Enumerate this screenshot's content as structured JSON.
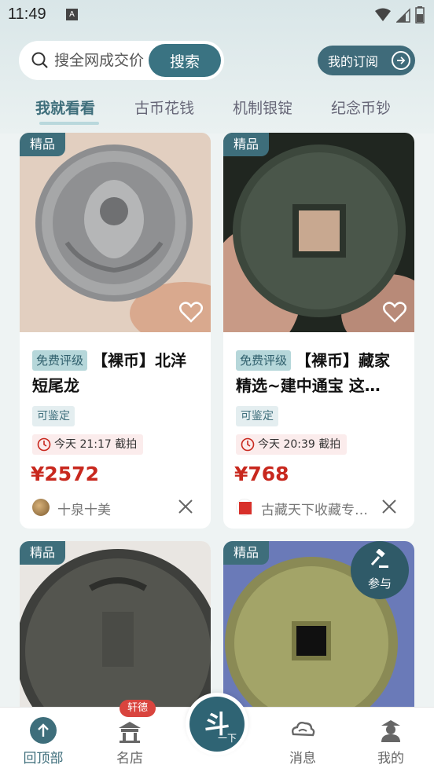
{
  "status_bar": {
    "time": "11:49",
    "notif_glyph": "A"
  },
  "search": {
    "placeholder": "搜全网成交价",
    "button_label": "搜索"
  },
  "subscribe": {
    "label": "我的订阅",
    "icon": "arrow-right-circle-icon"
  },
  "tabs": [
    {
      "label": "我就看看",
      "active": true
    },
    {
      "label": "古币花钱",
      "active": false
    },
    {
      "label": "机制银锭",
      "active": false
    },
    {
      "label": "纪念币钞",
      "active": false
    }
  ],
  "cards": [
    {
      "badge": "精品",
      "free_badge": "免费评级",
      "title": "【裸币】北洋短尾龙",
      "identify": "可鉴定",
      "time": "今天 21:17 截拍",
      "price": "¥2572",
      "seller": "十泉十美"
    },
    {
      "badge": "精品",
      "free_badge": "免费评级",
      "title": "【裸币】藏家精选~建中通宝 这…",
      "identify": "可鉴定",
      "time": "今天 20:39 截拍",
      "price": "¥768",
      "seller": "古藏天下收藏专…"
    },
    {
      "badge": "精品"
    },
    {
      "badge": "精品"
    }
  ],
  "participate": {
    "label": "参与"
  },
  "bottom_nav": {
    "items": [
      {
        "label": "回顶部",
        "icon": "arrow-up-icon",
        "active": true
      },
      {
        "label": "名店",
        "icon": "shop-icon",
        "badge": "轩德"
      },
      {
        "label": "消息",
        "icon": "cloud-message-icon"
      },
      {
        "label": "我的",
        "icon": "user-icon"
      }
    ],
    "center": {
      "main": "斗",
      "sub": "一下"
    }
  },
  "colors": {
    "primary": "#3e6e7b",
    "price_red": "#c8281e",
    "badge_red": "#d9443e"
  }
}
